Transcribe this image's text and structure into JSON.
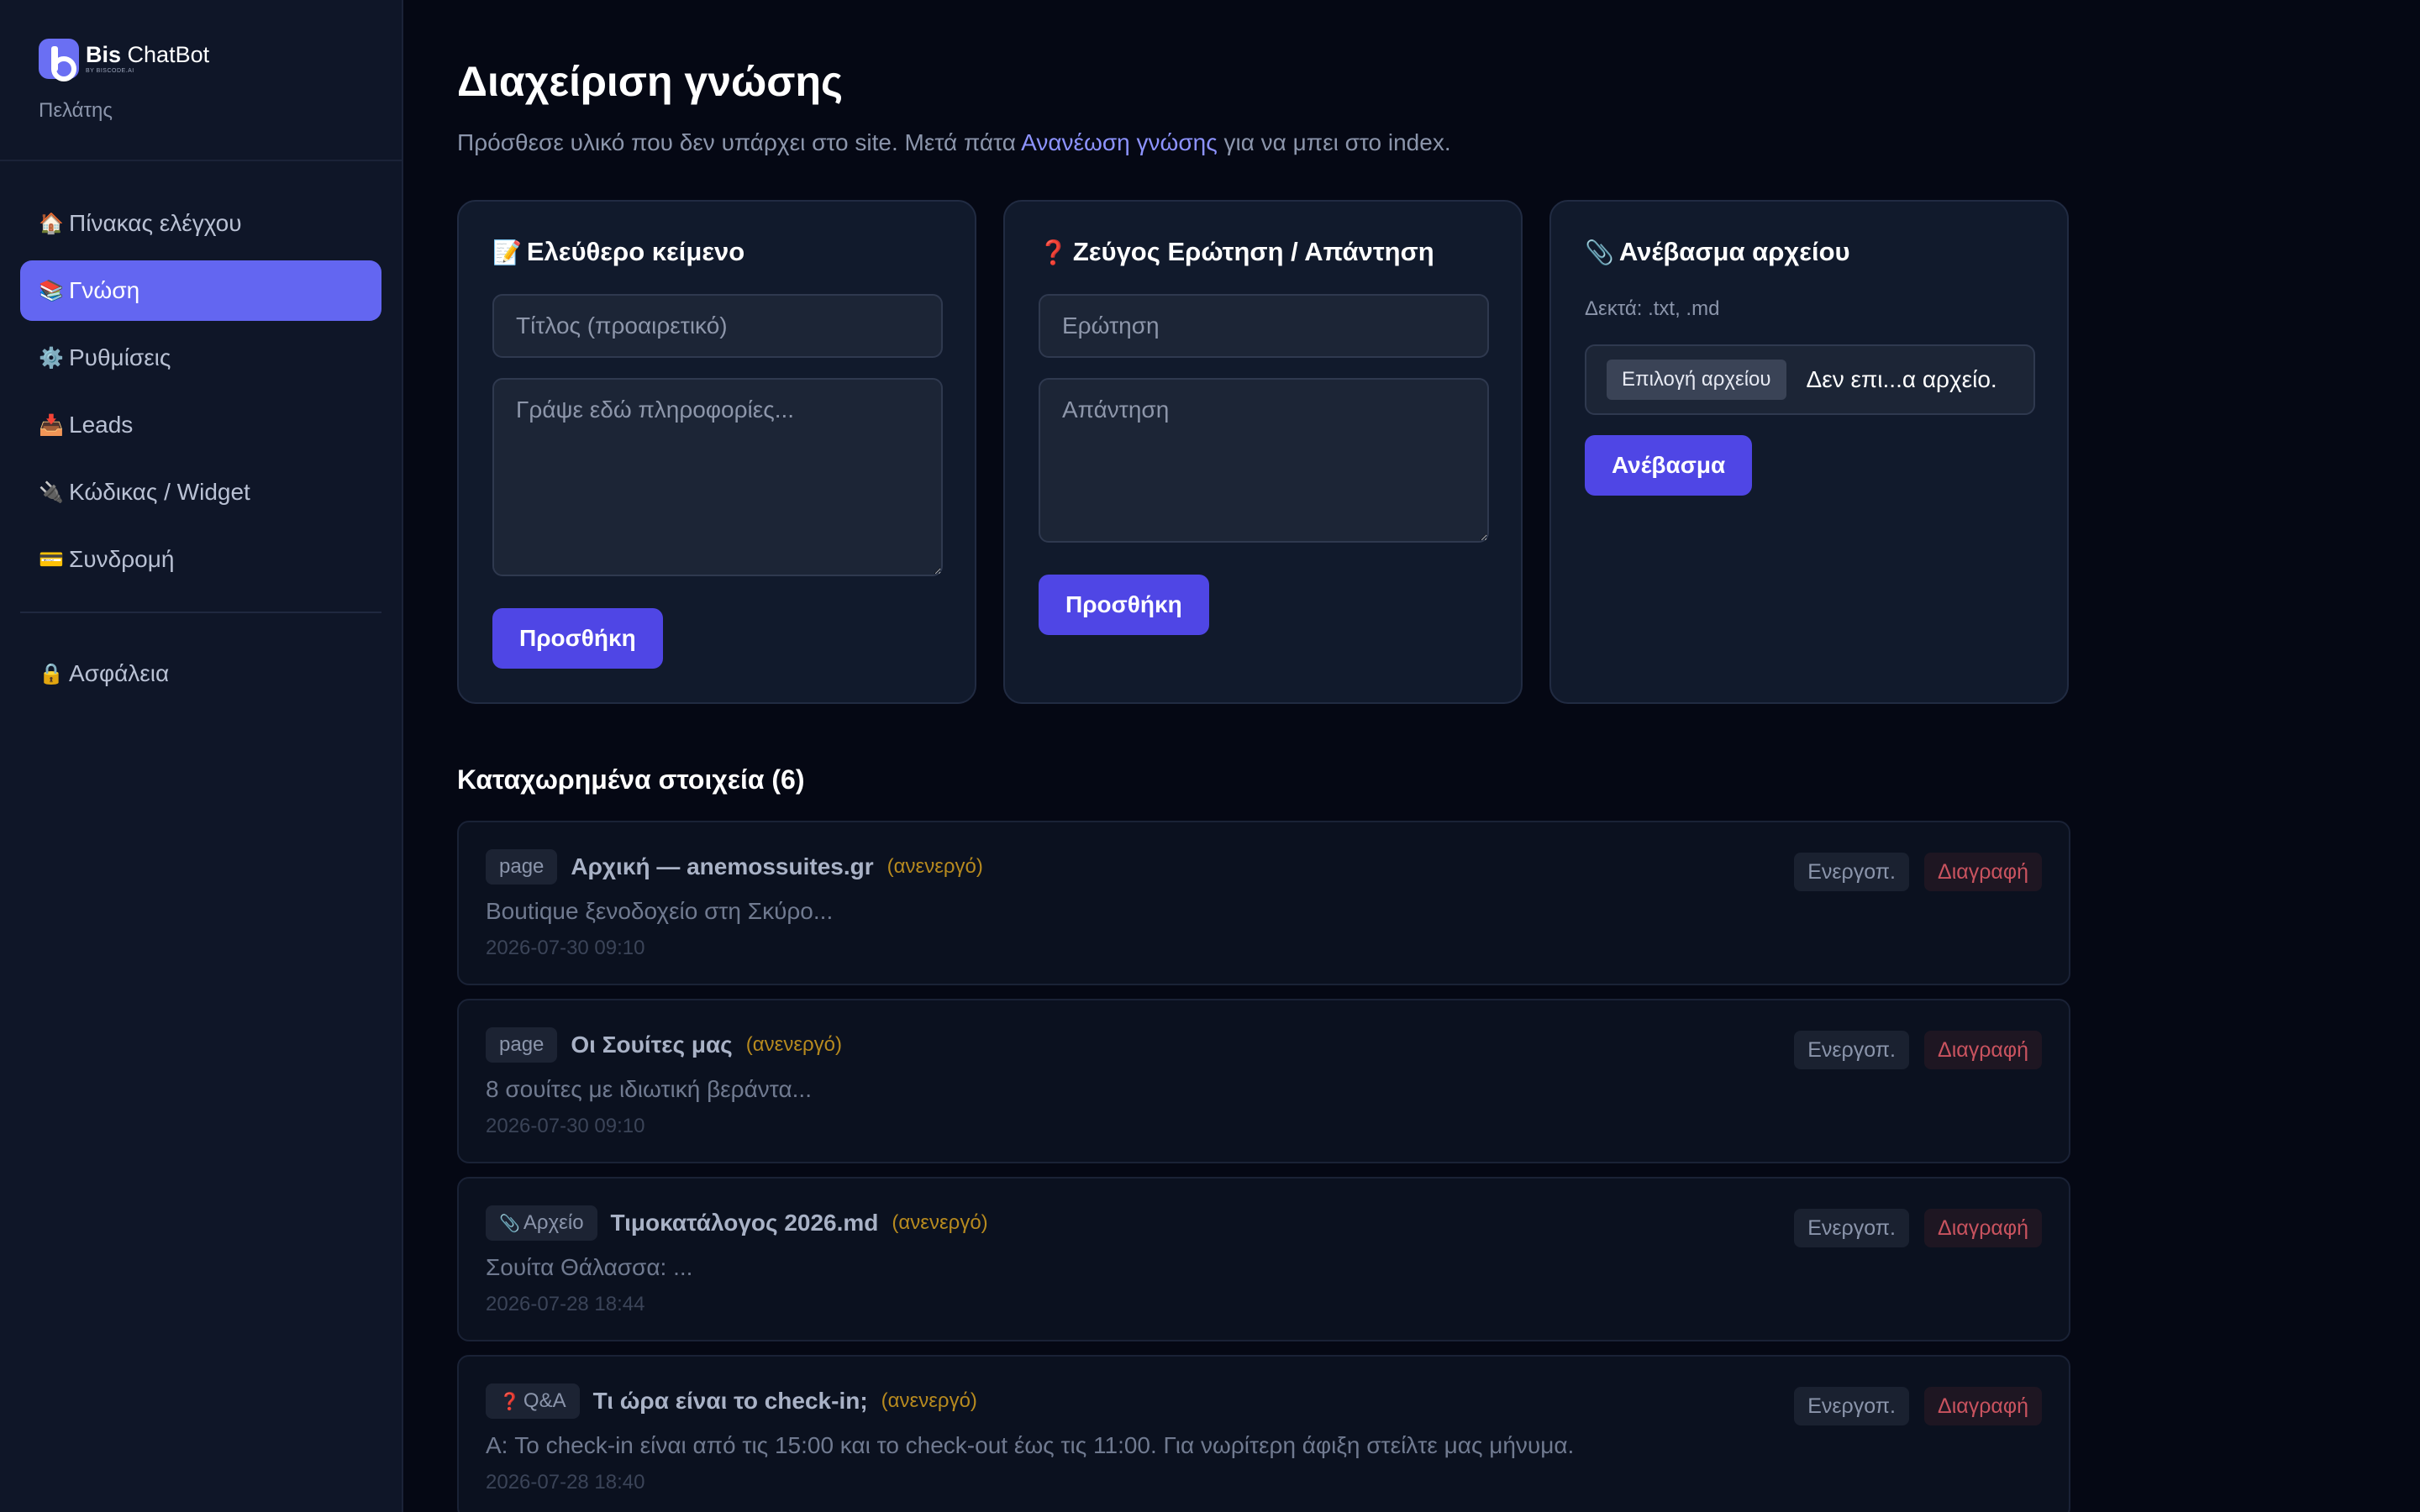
{
  "brand": {
    "name_bold": "Bis",
    "name_rest": " ChatBot",
    "sub": "BY BISCODE.AI",
    "role": "Πελάτης"
  },
  "sidebar": {
    "items": [
      {
        "emoji": "🏠",
        "label": "Πίνακας ελέγχου",
        "active": false
      },
      {
        "emoji": "📚",
        "label": "Γνώση",
        "active": true
      },
      {
        "emoji": "⚙️",
        "label": "Ρυθμίσεις",
        "active": false
      },
      {
        "emoji": "📥",
        "label": "Leads",
        "active": false
      },
      {
        "emoji": "🔌",
        "label": "Κώδικας / Widget",
        "active": false
      },
      {
        "emoji": "💳",
        "label": "Συνδρομή",
        "active": false
      }
    ],
    "security": {
      "emoji": "🔒",
      "label": "Ασφάλεια"
    }
  },
  "header": {
    "title": "Διαχείριση γνώσης",
    "subtitle_before": "Πρόσθεσε υλικό που δεν υπάρχει στο site. Μετά πάτα ",
    "subtitle_link": "Ανανέωση γνώσης",
    "subtitle_after": " για να μπει στο index."
  },
  "free_text": {
    "emoji": "📝",
    "title": "Ελεύθερο κείμενο",
    "title_placeholder": "Τίτλος (προαιρετικό)",
    "body_placeholder": "Γράψε εδώ πληροφορίες...",
    "button": "Προσθήκη"
  },
  "qa": {
    "emoji": "❓",
    "title": "Ζεύγος Ερώτηση / Απάντηση",
    "question_placeholder": "Ερώτηση",
    "answer_placeholder": "Απάντηση",
    "button": "Προσθήκη"
  },
  "upload": {
    "emoji": "📎",
    "title": "Ανέβασμα αρχείου",
    "accepted": "Δεκτά: .txt, .md",
    "choose": "Επιλογή αρχείου",
    "no_file": "Δεν επι...α αρχείο.",
    "button": "Ανέβασμα"
  },
  "list": {
    "title": "Καταχωρημένα στοιχεία (6)",
    "enable_label": "Ενεργοπ.",
    "delete_label": "Διαγραφή",
    "items": [
      {
        "tag_emoji": "",
        "tag": "page",
        "title": "Αρχική — anemossuites.gr",
        "status": "(ανενεργό)",
        "snippet": "Boutique ξενοδοχείο στη Σκύρο...",
        "date": "2026-07-30 09:10"
      },
      {
        "tag_emoji": "",
        "tag": "page",
        "title": "Οι Σουίτες μας",
        "status": "(ανενεργό)",
        "snippet": "8 σουίτες με ιδιωτική βεράντα...",
        "date": "2026-07-30 09:10"
      },
      {
        "tag_emoji": "📎",
        "tag": "Αρχείο",
        "title": "Τιμοκατάλογος 2026.md",
        "status": "(ανενεργό)",
        "snippet": "Σουίτα Θάλασσα: ...",
        "date": "2026-07-28 18:44"
      },
      {
        "tag_emoji": "❓",
        "tag": "Q&A",
        "title": "Τι ώρα είναι το check-in;",
        "status": "(ανενεργό)",
        "snippet": "A: Το check-in είναι από τις 15:00 και το check-out έως τις 11:00. Για νωρίτερη άφιξη στείλτε μας μήνυμα.",
        "date": "2026-07-28 18:40"
      }
    ]
  }
}
